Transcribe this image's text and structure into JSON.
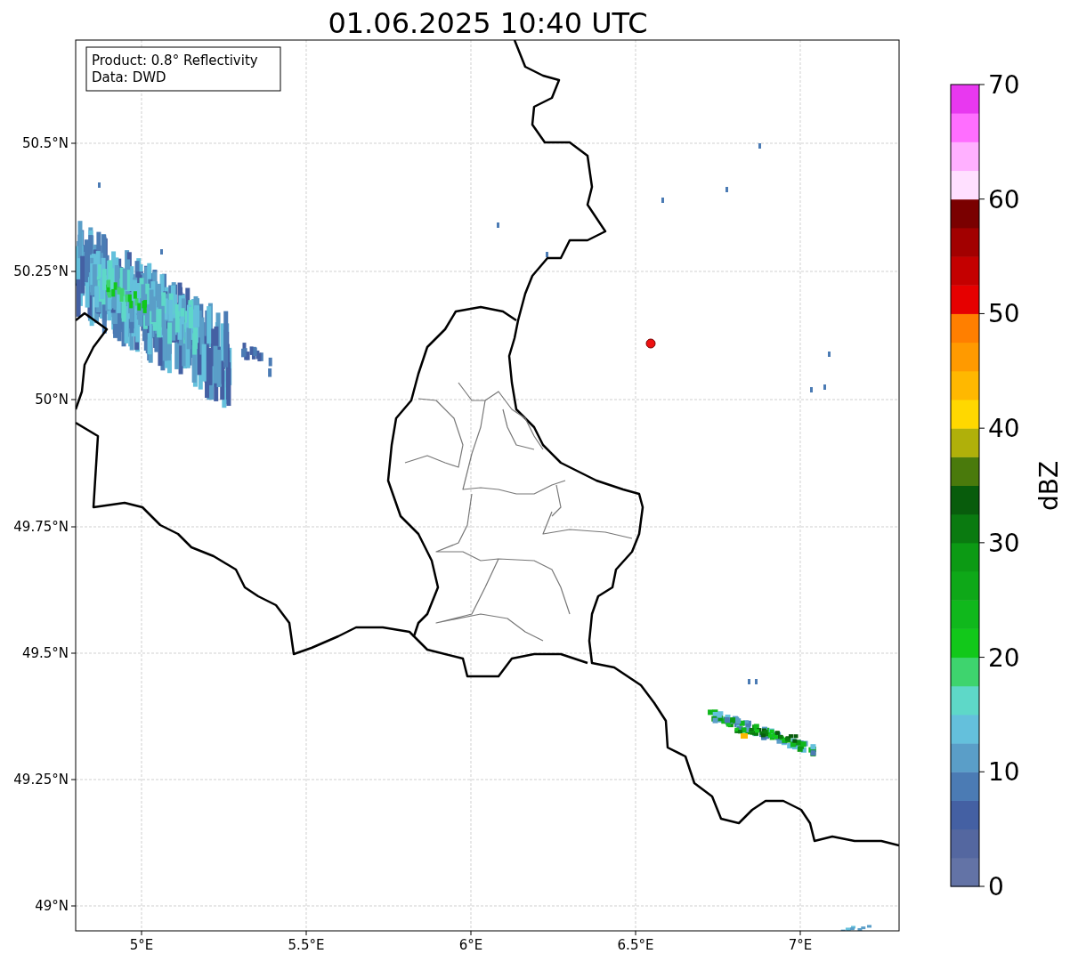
{
  "title": "01.06.2025 10:40 UTC",
  "info_box": [
    "Product: 0.8° Reflectivity",
    "Data: DWD"
  ],
  "y_tick_labels": [
    "50.5°N",
    "50.25°N",
    "50°N",
    "49.75°N",
    "49.5°N",
    "49.25°N",
    "49°N"
  ],
  "x_tick_labels": [
    "5°E",
    "5.5°E",
    "6°E",
    "6.5°E",
    "7°E"
  ],
  "colorbar": {
    "label": "dBZ",
    "ticks": [
      "70",
      "60",
      "50",
      "40",
      "30",
      "20",
      "10",
      "0"
    ],
    "bins": [
      {
        "color": "#6373a6"
      },
      {
        "color": "#5467a0"
      },
      {
        "color": "#4460a3"
      },
      {
        "color": "#4b7bb4"
      },
      {
        "color": "#5a9ec8"
      },
      {
        "color": "#64c0dc"
      },
      {
        "color": "#5ed8c8"
      },
      {
        "color": "#3ed46e"
      },
      {
        "color": "#12c81a"
      },
      {
        "color": "#10b81c"
      },
      {
        "color": "#0ea818"
      },
      {
        "color": "#0c9a14"
      },
      {
        "color": "#0a7a10"
      },
      {
        "color": "#085c0c"
      },
      {
        "color": "#4a7a0c"
      },
      {
        "color": "#b0b00a"
      },
      {
        "color": "#ffd800"
      },
      {
        "color": "#ffb800"
      },
      {
        "color": "#ff9a00"
      },
      {
        "color": "#ff7f00"
      },
      {
        "color": "#e60000"
      },
      {
        "color": "#c40000"
      },
      {
        "color": "#a20000"
      },
      {
        "color": "#7a0000"
      },
      {
        "color": "#ffe0ff"
      },
      {
        "color": "#ffb0ff"
      },
      {
        "color": "#ff6eff"
      },
      {
        "color": "#e838f0"
      }
    ]
  }
}
